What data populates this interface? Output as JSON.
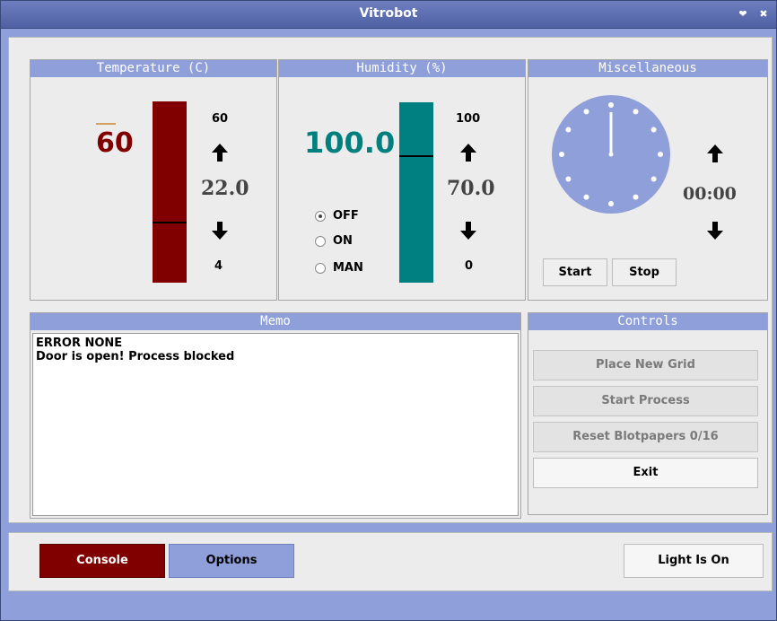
{
  "window": {
    "title": "Vitrobot",
    "minimize_glyph": "❤",
    "close_glyph": "✖"
  },
  "temperature": {
    "header": "Temperature (C)",
    "current": "60",
    "max": "60",
    "setpoint": "22.0",
    "min": "4",
    "current_color": "#800000"
  },
  "humidity": {
    "header": "Humidity (%)",
    "current": "100.0",
    "max": "100",
    "setpoint": "70.0",
    "min": "0",
    "current_color": "#007f7f",
    "modes": [
      {
        "label": "OFF",
        "selected": true
      },
      {
        "label": "ON",
        "selected": false
      },
      {
        "label": "MAN",
        "selected": false
      }
    ]
  },
  "misc": {
    "header": "Miscellaneous",
    "time": "00:00",
    "start_label": "Start",
    "stop_label": "Stop"
  },
  "memo": {
    "header": "Memo",
    "lines": "ERROR NONE\nDoor is open! Process blocked"
  },
  "controls": {
    "header": "Controls",
    "place_grid": "Place New Grid",
    "start_process": "Start Process",
    "reset_blotpapers": "Reset Blotpapers 0/16",
    "exit": "Exit"
  },
  "bottom": {
    "console": "Console",
    "options": "Options",
    "light": "Light Is On"
  },
  "colors": {
    "accent": "#8f9fd9",
    "temp_bar": "#800000",
    "humidity_bar": "#008080",
    "clock_face": "#8f9fd9",
    "console_active": "#800000"
  }
}
